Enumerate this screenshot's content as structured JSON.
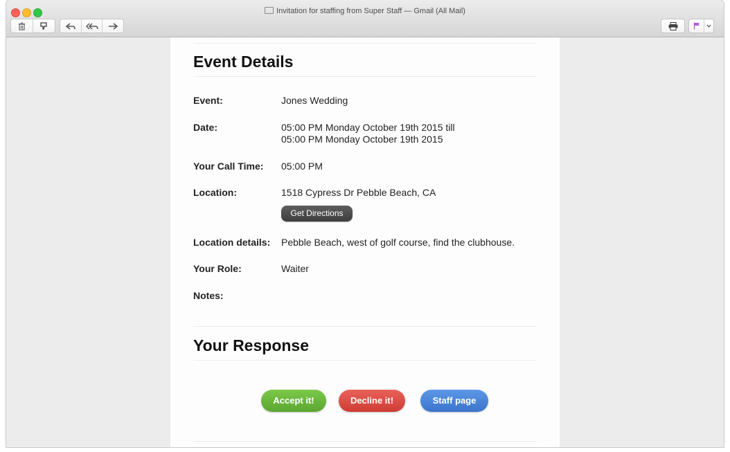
{
  "window": {
    "title": "Invitation for staffing from Super Staff — Gmail (All Mail)"
  },
  "toolbar": {
    "left_group1": [
      {
        "icon": "trash-icon"
      },
      {
        "icon": "junk-icon"
      }
    ],
    "left_group2": [
      {
        "icon": "reply-icon"
      },
      {
        "icon": "reply-all-icon"
      },
      {
        "icon": "forward-icon"
      }
    ],
    "right": [
      {
        "icon": "print-icon"
      },
      {
        "icon": "flag-icon"
      },
      {
        "icon": "chevron-down-icon"
      }
    ]
  },
  "event_details": {
    "heading": "Event Details",
    "event_label": "Event:",
    "event_value": "Jones Wedding",
    "date_label": "Date:",
    "date_line1": "05:00 PM Monday October 19th 2015 till",
    "date_line2": "05:00 PM Monday October 19th 2015",
    "call_label": "Your Call Time:",
    "call_value": "05:00 PM",
    "location_label": "Location:",
    "location_value": "1518 Cypress Dr Pebble Beach, CA",
    "directions_button": "Get Directions",
    "location_details_label": "Location details:",
    "location_details_value": "Pebble Beach, west of golf course, find the clubhouse.",
    "role_label": "Your Role:",
    "role_value": "Waiter",
    "notes_label": "Notes:"
  },
  "response": {
    "heading": "Your Response",
    "accept_label": "Accept it!",
    "decline_label": "Decline it!",
    "staff_label": "Staff page"
  },
  "colors": {
    "accept": "#69b53a",
    "decline": "#dc4a42",
    "staff": "#4a86da",
    "flag": "#b45ad6"
  }
}
